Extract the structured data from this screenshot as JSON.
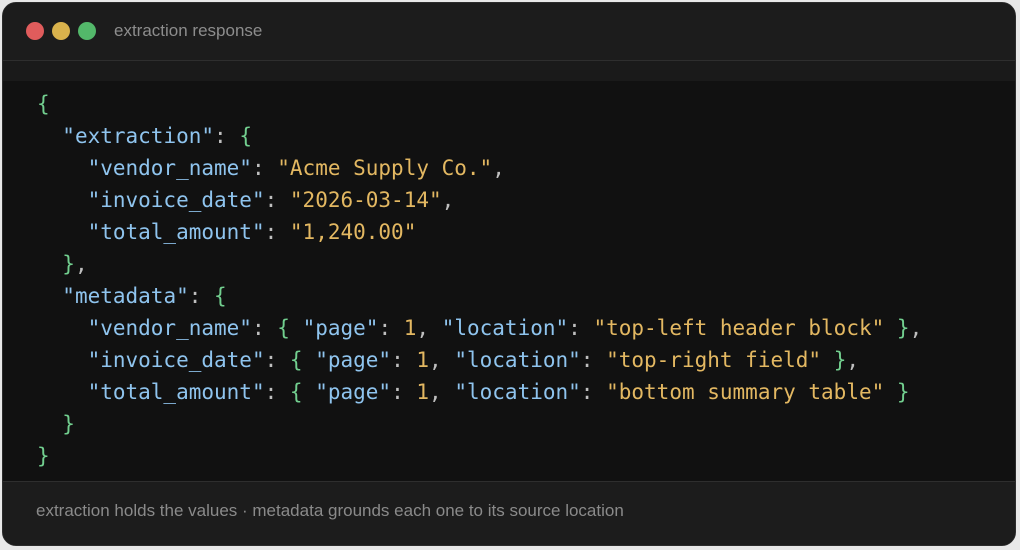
{
  "window": {
    "title": "extraction response",
    "controls": [
      "close",
      "minimize",
      "maximize"
    ]
  },
  "colors": {
    "key": "#8fc4ee",
    "string": "#e3b862",
    "brace": "#72cf8f",
    "close": "#e05c5c",
    "minimize": "#d9b24c",
    "maximize": "#53b86a"
  },
  "json": {
    "open": "{",
    "close": "}",
    "comma": ",",
    "colon": ":",
    "extraction": {
      "key": "\"extraction\"",
      "fields": [
        {
          "key": "\"vendor_name\"",
          "value": "\"Acme Supply Co.\""
        },
        {
          "key": "\"invoice_date\"",
          "value": "\"2026-03-14\""
        },
        {
          "key": "\"total_amount\"",
          "value": "\"1,240.00\""
        }
      ]
    },
    "metadata": {
      "key": "\"metadata\"",
      "page_key": "\"page\"",
      "location_key": "\"location\"",
      "fields": [
        {
          "key": "\"vendor_name\"",
          "page": "1",
          "location": "\"top-left header block\""
        },
        {
          "key": "\"invoice_date\"",
          "page": "1",
          "location": "\"top-right field\""
        },
        {
          "key": "\"total_amount\"",
          "page": "1",
          "location": "\"bottom summary table\""
        }
      ]
    }
  },
  "footer": {
    "caption": "extraction holds the values · metadata grounds each one to its source location"
  }
}
